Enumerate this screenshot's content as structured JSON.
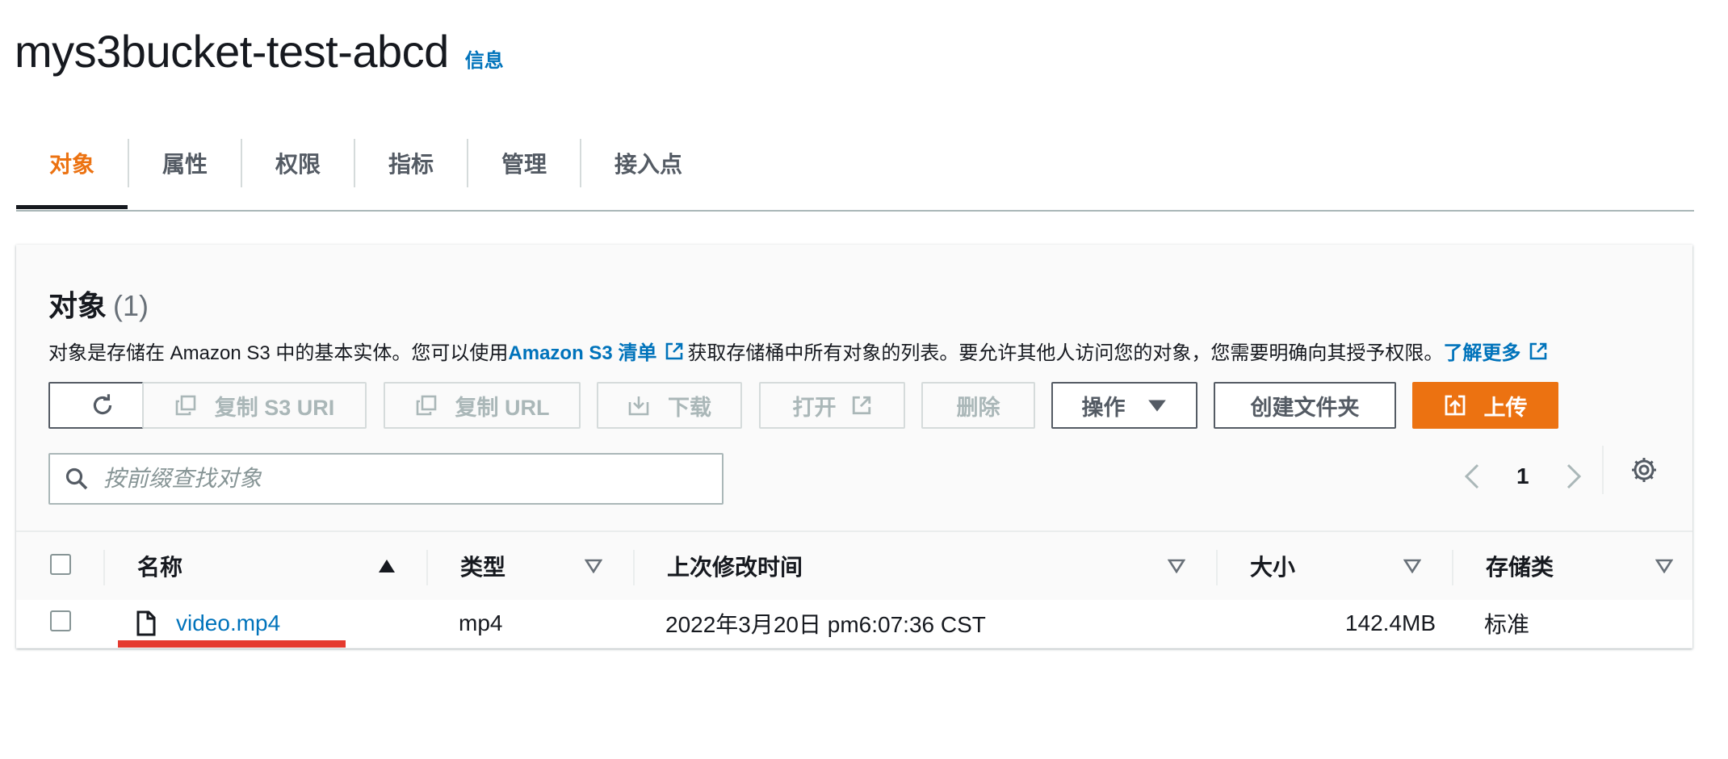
{
  "header": {
    "bucket_name": "mys3bucket-test-abcd",
    "info_link": "信息"
  },
  "tabs": [
    {
      "label": "对象",
      "active": true
    },
    {
      "label": "属性"
    },
    {
      "label": "权限"
    },
    {
      "label": "指标"
    },
    {
      "label": "管理"
    },
    {
      "label": "接入点"
    }
  ],
  "objects_panel": {
    "title": "对象",
    "count": "(1)",
    "description_part1": "对象是存储在 Amazon S3 中的基本实体。您可以使用 ",
    "inventory_link": "Amazon S3 清单",
    "description_part2": "获取存储桶中所有对象的列表。要允许其他人访问您的对象，您需要明确向其授予权限。",
    "learn_more_link": "了解更多"
  },
  "toolbar": {
    "refresh_icon": "refresh-icon",
    "copy_s3_uri": "复制 S3 URI",
    "copy_url": "复制 URL",
    "download": "下载",
    "open": "打开",
    "delete": "删除",
    "actions": "操作",
    "create_folder": "创建文件夹",
    "upload": "上传"
  },
  "search": {
    "placeholder": "按前缀查找对象",
    "value": ""
  },
  "pagination": {
    "current_page": "1"
  },
  "table": {
    "columns": [
      "名称",
      "类型",
      "上次修改时间",
      "大小",
      "存储类"
    ],
    "rows": [
      {
        "name": "video.mp4",
        "type": "mp4",
        "last_modified": "2022年3月20日 pm6:07:36 CST",
        "size": "142.4MB",
        "storage_class": "标准"
      }
    ]
  },
  "colors": {
    "accent_orange": "#ec7211",
    "link_blue": "#0073bb",
    "highlight_red": "#e53a2f",
    "text_dark": "#16191f",
    "disabled_gray": "#aab7b8"
  }
}
